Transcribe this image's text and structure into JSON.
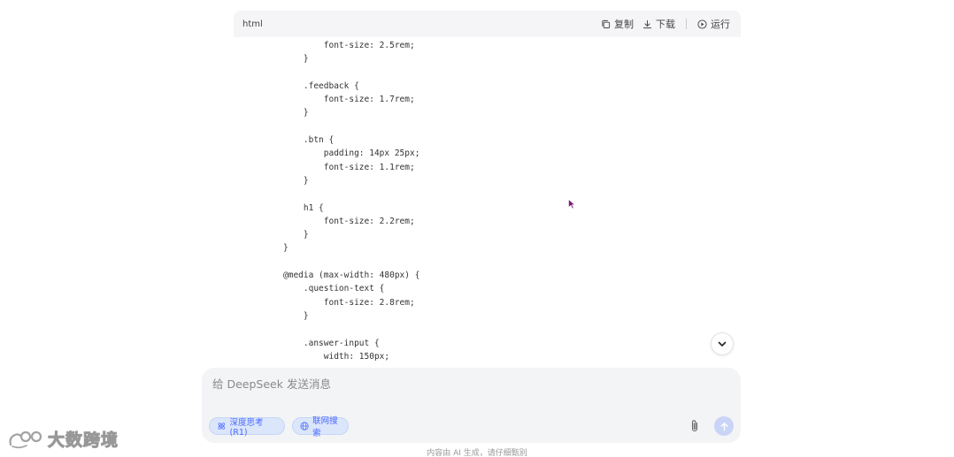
{
  "code_block": {
    "language": "html",
    "copy_label": "复制",
    "download_label": "下载",
    "run_label": "运行",
    "lines": [
      "        font-size: 2.5rem;",
      "    }",
      "",
      "    .feedback {",
      "        font-size: 1.7rem;",
      "    }",
      "",
      "    .btn {",
      "        padding: 14px 25px;",
      "        font-size: 1.1rem;",
      "    }",
      "",
      "    h1 {",
      "        font-size: 2.2rem;",
      "    }",
      "}",
      "",
      "@media (max-width: 480px) {",
      "    .question-text {",
      "        font-size: 2.8rem;",
      "    }",
      "",
      "    .answer-input {",
      "        width: 150px;"
    ]
  },
  "chat": {
    "placeholder": "给 DeepSeek 发送消息",
    "deep_think_label": "深度思考 (R1)",
    "web_search_label": "联网搜索"
  },
  "disclaimer": "内容由 AI 生成，请仔细甄别",
  "watermark": {
    "text": "大数跨境"
  },
  "colors": {
    "accent": "#4d6bfe",
    "pill_bg": "#dbe6fb",
    "input_bg": "#f3f4f6",
    "send_bg": "#c9d4f6"
  }
}
